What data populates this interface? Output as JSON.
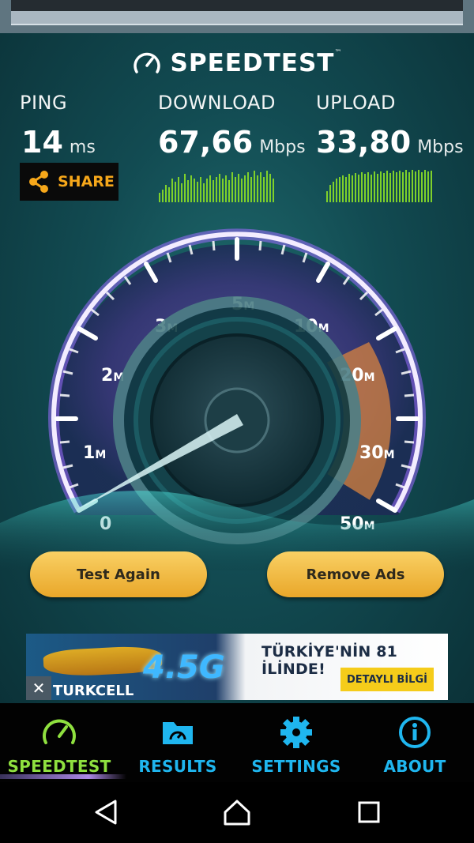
{
  "app": {
    "logo_text": "SPEEDTEST",
    "logo_tm": "™"
  },
  "metrics": {
    "ping": {
      "label": "PING",
      "value": "14",
      "unit": "ms"
    },
    "download": {
      "label": "DOWNLOAD",
      "value": "67,66",
      "unit": "Mbps"
    },
    "upload": {
      "label": "UPLOAD",
      "value": "33,80",
      "unit": "Mbps"
    }
  },
  "share": {
    "label": "SHARE",
    "icon": "share-icon",
    "color": "#f6a71a"
  },
  "gauge": {
    "ticks": [
      {
        "num": "0",
        "unit": ""
      },
      {
        "num": "1",
        "unit": "M"
      },
      {
        "num": "2",
        "unit": "M"
      },
      {
        "num": "3",
        "unit": "M"
      },
      {
        "num": "5",
        "unit": "M"
      },
      {
        "num": "10",
        "unit": "M"
      },
      {
        "num": "20",
        "unit": "M"
      },
      {
        "num": "30",
        "unit": "M"
      },
      {
        "num": "50",
        "unit": "M"
      }
    ],
    "needle_position": 0,
    "highlight_range": [
      "20M",
      "50M"
    ],
    "colors": {
      "rim": "#e8d8ff",
      "glow": "#9a6cff",
      "highlight": "#d8833f"
    }
  },
  "actions": {
    "test_again": "Test Again",
    "remove_ads": "Remove Ads"
  },
  "ad": {
    "tag": "4.5G",
    "headline": "TÜRKİYE'NİN 81 İLİNDE!",
    "cta": "DETAYLI BİLGİ",
    "brand": "TURKCELL",
    "close": "✕"
  },
  "tabs": [
    {
      "label": "SPEEDTEST",
      "icon": "speedometer-icon",
      "color": "#8fe03f"
    },
    {
      "label": "RESULTS",
      "icon": "results-folder-icon",
      "color": "#1fb6ef"
    },
    {
      "label": "SETTINGS",
      "icon": "gear-icon",
      "color": "#1fb6ef"
    },
    {
      "label": "ABOUT",
      "icon": "info-icon",
      "color": "#1fb6ef"
    }
  ],
  "navigation": [
    "back-icon",
    "home-icon",
    "recents-icon"
  ]
}
